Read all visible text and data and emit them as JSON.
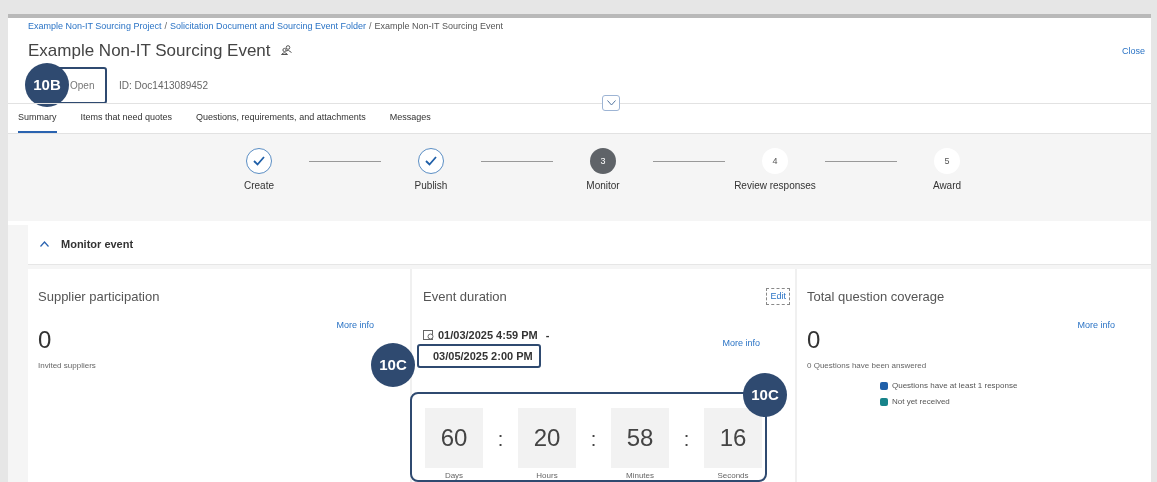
{
  "breadcrumb": [
    {
      "label": "Example Non-IT Sourcing Project",
      "kind": "link"
    },
    {
      "label": "Solicitation Document and Sourcing Event Folder",
      "kind": "link"
    },
    {
      "label": "Example Non-IT Sourcing Event",
      "kind": "current"
    }
  ],
  "breadcrumb_separator": "/",
  "title": "Example Non-IT Sourcing Event",
  "close": "Close",
  "status": {
    "label": "Open",
    "callout": "10B"
  },
  "doc_id": "ID: Doc1413089452",
  "tabs": [
    {
      "label": "Summary",
      "selected": true
    },
    {
      "label": "Items that need quotes",
      "selected": false
    },
    {
      "label": "Questions, requirements, and attachments",
      "selected": false
    },
    {
      "label": "Messages",
      "selected": false
    }
  ],
  "steps": [
    {
      "label": "Create",
      "kind": "done"
    },
    {
      "label": "Publish",
      "kind": "done"
    },
    {
      "label": "Monitor",
      "kind": "current",
      "number": "3"
    },
    {
      "label": "Review responses",
      "kind": "upcoming",
      "number": "4"
    },
    {
      "label": "Award",
      "kind": "upcoming",
      "number": "5"
    }
  ],
  "section": {
    "title": "Monitor event",
    "expanded": true
  },
  "cards": [
    {
      "kind": "count",
      "title": "Supplier participation",
      "more": "More info",
      "value": "0",
      "caption": "Invited suppliers"
    },
    {
      "kind": "duration",
      "title": "Event duration",
      "action": "Edit",
      "more": "More info",
      "start": "01/03/2025 4:59 PM",
      "range_separator": "-",
      "end": "03/05/2025 2:00 PM",
      "end_callout": "10C",
      "countdown_callout": "10C",
      "countdown_separator": ":",
      "countdown": [
        {
          "value": "60",
          "unit": "Days"
        },
        {
          "value": "20",
          "unit": "Hours"
        },
        {
          "value": "58",
          "unit": "Minutes"
        },
        {
          "value": "16",
          "unit": "Seconds"
        }
      ]
    },
    {
      "kind": "coverage",
      "title": "Total question coverage",
      "more": "More info",
      "value": "0",
      "caption": "0 Questions have been answered",
      "legend": [
        {
          "label": "Questions have at least 1 response",
          "color": "#1f5fa8"
        },
        {
          "label": "Not yet received",
          "color": "#17838a"
        }
      ]
    }
  ]
}
